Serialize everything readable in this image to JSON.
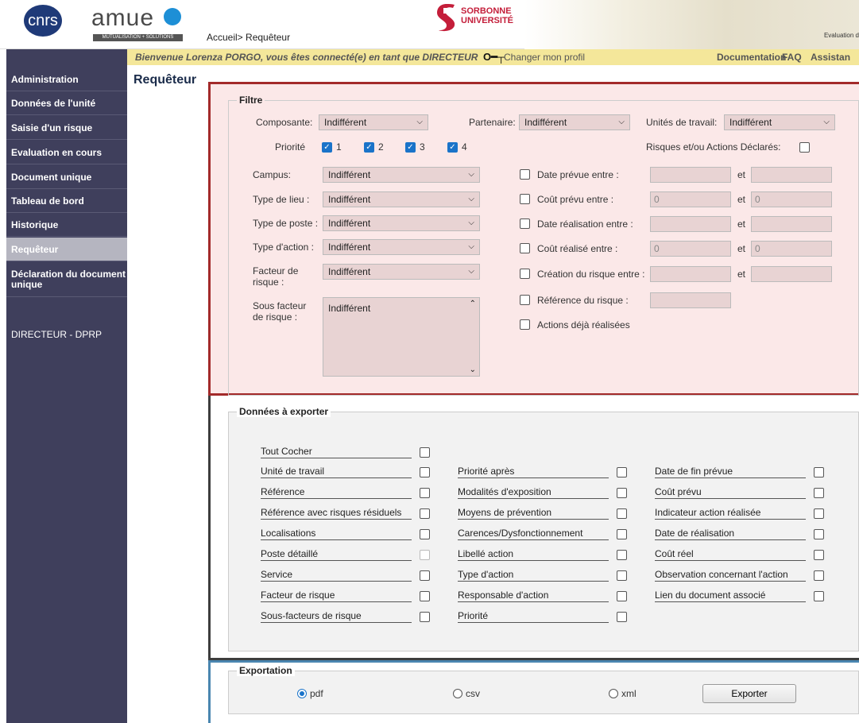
{
  "header": {
    "cnrs_logo": "cnrs",
    "amue_logo": "amue",
    "amue_sub": "MUTUALISATION + SOLUTIONS",
    "breadcrumb": "Accueil> Requêteur",
    "sorbonne_line1": "SORBONNE",
    "sorbonne_line2": "UNIVERSITÉ",
    "header_image_text": "Evaluation d"
  },
  "welcome": {
    "text": "Bienvenue Lorenza PORGO, vous êtes connecté(e) en tant que DIRECTEUR",
    "key_icon": "key-icon",
    "change_profile": "Changer mon profil",
    "documentation": "Documentation",
    "faq": "FAQ",
    "assistance": "Assistan"
  },
  "sidebar": {
    "items": [
      {
        "label": "Administration"
      },
      {
        "label": "Données de l'unité"
      },
      {
        "label": "Saisie d'un risque"
      },
      {
        "label": "Evaluation en cours"
      },
      {
        "label": "Document unique"
      },
      {
        "label": "Tableau de bord"
      },
      {
        "label": "Historique"
      },
      {
        "label": "Requêteur"
      },
      {
        "label": "Déclaration du document unique"
      }
    ],
    "role": "DIRECTEUR - DPRP"
  },
  "page_title": "Requêteur",
  "filter": {
    "legend": "Filtre",
    "composante_label": "Composante:",
    "composante_value": "Indifférent",
    "partenaire_label": "Partenaire:",
    "partenaire_value": "Indifférent",
    "unites_label": "Unités de travail:",
    "unites_value": "Indifférent",
    "priorite_label": "Priorité",
    "priorites": [
      "1",
      "2",
      "3",
      "4"
    ],
    "risques_declares_label": "Risques et/ou Actions Déclarés:",
    "campus_label": "Campus:",
    "campus_value": "Indifférent",
    "type_lieu_label": "Type de lieu :",
    "type_lieu_value": "Indifférent",
    "type_poste_label": "Type de poste :",
    "type_poste_value": "Indifférent",
    "type_action_label": "Type d'action :",
    "type_action_value": "Indifférent",
    "facteur_label": "Facteur de risque :",
    "facteur_value": "Indifférent",
    "sous_facteur_label": "Sous facteur de risque :",
    "sous_facteur_value": "Indifférent",
    "date_prevue_label": "Date prévue entre :",
    "cout_prevu_label": "Coût prévu entre :",
    "cout_prevu_min": "0",
    "cout_prevu_max": "0",
    "date_realisation_label": "Date réalisation entre :",
    "cout_realise_label": "Coût réalisé entre :",
    "cout_realise_min": "0",
    "cout_realise_max": "0",
    "creation_label": "Création du risque entre :",
    "reference_label": "Référence du risque :",
    "actions_realisees_label": "Actions déjà réalisées",
    "et": "et"
  },
  "export": {
    "legend": "Données à exporter",
    "tout_cocher": "Tout Cocher",
    "col1": [
      "Unité de travail",
      "Référence",
      "Référence avec risques résiduels",
      "Localisations",
      "Poste détaillé",
      "Service",
      "Facteur de risque",
      "Sous-facteurs de risque"
    ],
    "col2": [
      "Priorité après",
      "Modalités d'exposition",
      "Moyens de prévention",
      "Carences/Dysfonctionnement",
      "Libellé action",
      "Type d'action",
      "Responsable d'action",
      "Priorité"
    ],
    "col3": [
      "Date de fin prévue",
      "Coût prévu",
      "Indicateur action réalisée",
      "Date de réalisation",
      "Coût réel",
      "Observation concernant l'action",
      "Lien du document associé"
    ]
  },
  "exportation": {
    "legend": "Exportation",
    "pdf": "pdf",
    "csv": "csv",
    "xml": "xml",
    "button": "Exporter"
  }
}
